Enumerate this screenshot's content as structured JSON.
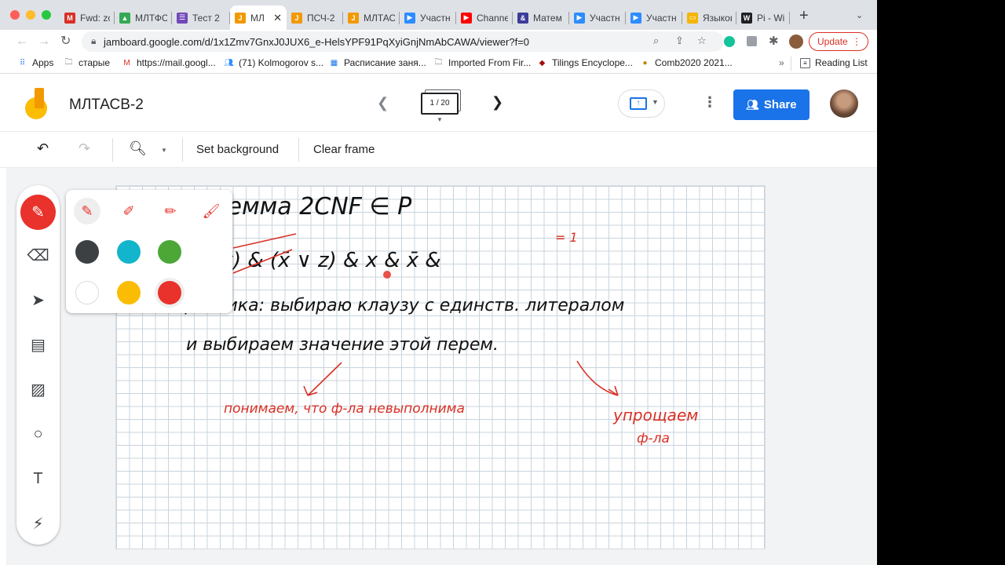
{
  "tabs": [
    {
      "title": "Fwd: zo",
      "icon": "gmail-icon",
      "color": "#d93025",
      "glyph": "M"
    },
    {
      "title": "МЛТФС",
      "icon": "drive-icon",
      "color": "#34a853",
      "glyph": "▲"
    },
    {
      "title": "Тест 2",
      "icon": "forms-icon",
      "color": "#7248b9",
      "glyph": "☰"
    },
    {
      "title": "МЛ",
      "icon": "jamboard-icon",
      "color": "#f29900",
      "glyph": "J",
      "active": true
    },
    {
      "title": "ПСЧ-2",
      "icon": "jamboard-icon",
      "color": "#f29900",
      "glyph": "J"
    },
    {
      "title": "МЛТАС",
      "icon": "jamboard-icon",
      "color": "#f29900",
      "glyph": "J"
    },
    {
      "title": "Участн",
      "icon": "zoom-icon",
      "color": "#2d8cff",
      "glyph": "▶"
    },
    {
      "title": "Channe",
      "icon": "youtube-icon",
      "color": "#ff0000",
      "glyph": "▶"
    },
    {
      "title": "Матем",
      "icon": "ampersand-icon",
      "color": "#3c3c9a",
      "glyph": "&"
    },
    {
      "title": "Участн",
      "icon": "zoom-icon",
      "color": "#2d8cff",
      "glyph": "▶"
    },
    {
      "title": "Участн",
      "icon": "zoom-icon",
      "color": "#2d8cff",
      "glyph": "▶"
    },
    {
      "title": "Языков",
      "icon": "slides-icon",
      "color": "#f4b400",
      "glyph": "▭"
    },
    {
      "title": "Pi - Wik",
      "icon": "wikipedia-icon",
      "color": "#202124",
      "glyph": "W"
    }
  ],
  "address": {
    "url": "jamboard.google.com/d/1x1Zmv7GnxJ0JUX6_e-HelsYPF91PqXyiGnjNmAbCAWA/viewer?f=0",
    "update_label": "Update"
  },
  "bookmarks": [
    {
      "label": "Apps",
      "icon": "apps-grid-icon"
    },
    {
      "label": "старые",
      "icon": "folder-icon"
    },
    {
      "label": "https://mail.googl...",
      "icon": "gmail-icon"
    },
    {
      "label": "(71) Kolmogorov s...",
      "icon": "people-icon"
    },
    {
      "label": "Расписание заня...",
      "icon": "calendar-icon"
    },
    {
      "label": "Imported From Fir...",
      "icon": "folder-icon"
    },
    {
      "label": "Tilings Encyclope...",
      "icon": "tiling-icon"
    },
    {
      "label": "Comb2020 2021...",
      "icon": "comb-icon"
    }
  ],
  "reading_list": "Reading List",
  "header": {
    "title": "МЛТАСВ-2",
    "frame_indicator": "1 / 20",
    "share_label": "Share"
  },
  "toolbar": {
    "set_background": "Set background",
    "clear_frame": "Clear frame"
  },
  "pen_popup": {
    "pens": [
      "pen",
      "marker",
      "highlighter",
      "brush"
    ],
    "colors": [
      "#3c4043",
      "#12b5cb",
      "#4ca737",
      "#ffffff",
      "#fbbc04",
      "#e8322b"
    ],
    "selected_color": "#e8322b"
  },
  "board": {
    "line1": "Лемма 2CNF ∈ P",
    "line2": "(x∨y) & (x̄ ∨ z) & x & x̄ &",
    "sup": "= 1",
    "line3": "Эвристика: выбираю клаузу с единств. литералом",
    "line4": "и выбираем значение этой перем.",
    "note_left": "понимаем, что ф-ла невыполнима",
    "note_right_1": "упрощаем",
    "note_right_2": "ф-ла"
  }
}
